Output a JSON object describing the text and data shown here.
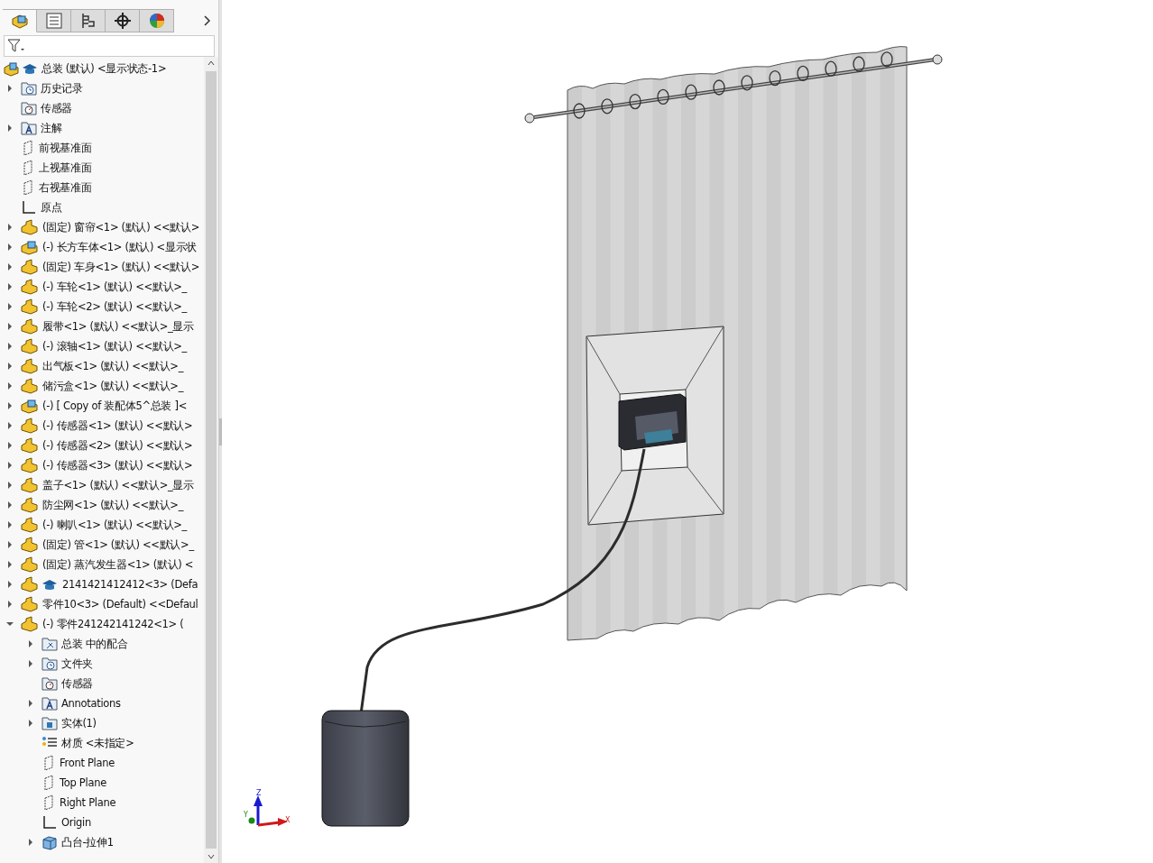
{
  "panel_tabs": [
    {
      "kind": "feature-tree",
      "selected": true
    },
    {
      "kind": "property",
      "selected": false
    },
    {
      "kind": "config",
      "selected": false
    },
    {
      "kind": "dimxpert",
      "selected": false
    },
    {
      "kind": "display",
      "selected": false
    }
  ],
  "tree": {
    "label": "总装 (默认) <显示状态-1>",
    "kind": "assembly",
    "children": [
      {
        "label": "历史记录",
        "kind": "history-folder",
        "expanded": false
      },
      {
        "label": "传感器",
        "kind": "sensor-folder"
      },
      {
        "label": "注解",
        "kind": "annotation-folder",
        "expanded": false
      },
      {
        "label": "前视基准面",
        "kind": "plane"
      },
      {
        "label": "上视基准面",
        "kind": "plane"
      },
      {
        "label": "右视基准面",
        "kind": "plane"
      },
      {
        "label": "原点",
        "kind": "origin"
      },
      {
        "label": "(固定) 窗帘<1> (默认) <<默认>",
        "kind": "part",
        "expanded": false
      },
      {
        "label": "(-) 长方车体<1> (默认) <显示状",
        "kind": "subassembly",
        "expanded": false
      },
      {
        "label": "(固定) 车身<1> (默认) <<默认>",
        "kind": "part",
        "expanded": false
      },
      {
        "label": "(-) 车轮<1> (默认) <<默认>_",
        "kind": "part",
        "expanded": false
      },
      {
        "label": "(-) 车轮<2> (默认) <<默认>_",
        "kind": "part",
        "expanded": false
      },
      {
        "label": "履带<1> (默认) <<默认>_显示",
        "kind": "part",
        "expanded": false
      },
      {
        "label": "(-) 滚轴<1> (默认) <<默认>_",
        "kind": "part",
        "expanded": false
      },
      {
        "label": "出气板<1> (默认) <<默认>_",
        "kind": "part",
        "expanded": false
      },
      {
        "label": "储污盒<1> (默认) <<默认>_",
        "kind": "part",
        "expanded": false
      },
      {
        "label": "(-) [ Copy of 装配体5^总装 ]<",
        "kind": "subassembly",
        "expanded": false
      },
      {
        "label": "(-) 传感器<1> (默认) <<默认>",
        "kind": "part",
        "expanded": false
      },
      {
        "label": "(-) 传感器<2> (默认) <<默认>",
        "kind": "part",
        "expanded": false
      },
      {
        "label": "(-) 传感器<3> (默认) <<默认>",
        "kind": "part",
        "expanded": false
      },
      {
        "label": "盖子<1> (默认) <<默认>_显示",
        "kind": "part",
        "expanded": false
      },
      {
        "label": "防尘网<1> (默认) <<默认>_",
        "kind": "part",
        "expanded": false
      },
      {
        "label": "(-) 喇叭<1> (默认) <<默认>_",
        "kind": "part",
        "expanded": false
      },
      {
        "label": "(固定) 管<1> (默认) <<默认>_",
        "kind": "part",
        "expanded": false
      },
      {
        "label": "(固定) 蒸汽发生器<1> (默认) <",
        "kind": "part",
        "expanded": false
      },
      {
        "label": "2141421412412<3> (Defa",
        "kind": "part-assembly",
        "expanded": false
      },
      {
        "label": "零件10<3> (Default) <<Defaul",
        "kind": "part",
        "expanded": false
      },
      {
        "label": "(-) 零件241242141242<1> (",
        "kind": "part",
        "expanded": true,
        "children": [
          {
            "label": "总装 中的配合",
            "kind": "mates-folder",
            "expanded": false
          },
          {
            "label": "文件夹",
            "kind": "history-folder",
            "expanded": false
          },
          {
            "label": "传感器",
            "kind": "sensor-folder"
          },
          {
            "label": "Annotations",
            "kind": "annotation-folder",
            "expanded": false
          },
          {
            "label": "实体(1)",
            "kind": "body-folder",
            "expanded": false
          },
          {
            "label": "材质 <未指定>",
            "kind": "material"
          },
          {
            "label": "Front Plane",
            "kind": "plane"
          },
          {
            "label": "Top Plane",
            "kind": "plane"
          },
          {
            "label": "Right Plane",
            "kind": "plane"
          },
          {
            "label": "Origin",
            "kind": "origin"
          },
          {
            "label": "凸台-拉伸1",
            "kind": "extrude",
            "expanded": false
          }
        ]
      }
    ]
  },
  "triad": {
    "x": "X",
    "y": "Y",
    "z": "Z"
  }
}
